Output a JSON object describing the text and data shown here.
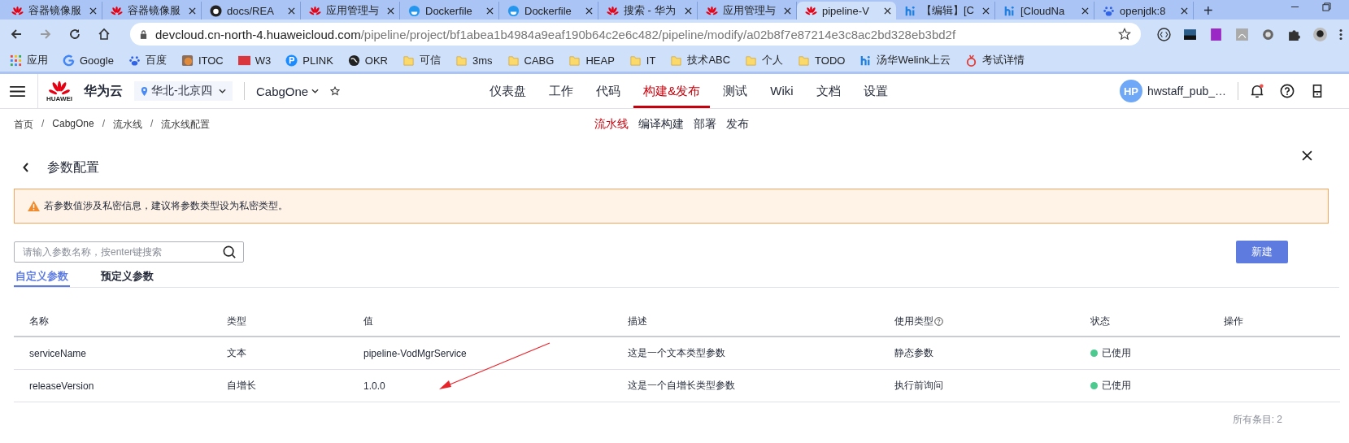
{
  "browser": {
    "tabs": [
      {
        "title": "容器镜像服",
        "kind": "huawei",
        "selected": false
      },
      {
        "title": "容器镜像服",
        "kind": "huawei",
        "selected": false
      },
      {
        "title": "docs/REA",
        "kind": "github",
        "selected": false
      },
      {
        "title": "应用管理与",
        "kind": "huawei",
        "selected": false
      },
      {
        "title": "Dockerfile",
        "kind": "docker",
        "selected": false
      },
      {
        "title": "Dockerfile",
        "kind": "docker",
        "selected": false
      },
      {
        "title": "搜索 - 华为",
        "kind": "huawei",
        "selected": false
      },
      {
        "title": "应用管理与",
        "kind": "huawei",
        "selected": false
      },
      {
        "title": "pipeline-V",
        "kind": "huawei",
        "selected": true
      },
      {
        "title": "【编辑】[C",
        "kind": "welink",
        "selected": false
      },
      {
        "title": "[CloudNa",
        "kind": "welink",
        "selected": false
      },
      {
        "title": "openjdk:8",
        "kind": "baidu",
        "selected": false
      }
    ],
    "new_tab": "+",
    "url_host": "devcloud.cn-north-4.huaweicloud.com",
    "url_path": "/pipeline/project/bf1abea1b4984a9eaf190b64c2e6c482/pipeline/modify/a02b8f7e87214e3c8ac2bd328eb3bd2f",
    "bookmarks": [
      {
        "label": "应用",
        "kind": "apps"
      },
      {
        "label": "Google",
        "kind": "google"
      },
      {
        "label": "百度",
        "kind": "baidu"
      },
      {
        "label": "ITOC",
        "kind": "itoc"
      },
      {
        "label": "W3",
        "kind": "w3"
      },
      {
        "label": "PLINK",
        "kind": "plink"
      },
      {
        "label": "OKR",
        "kind": "okr"
      },
      {
        "label": "可信",
        "kind": "folder"
      },
      {
        "label": "3ms",
        "kind": "folder"
      },
      {
        "label": "CABG",
        "kind": "folder"
      },
      {
        "label": "HEAP",
        "kind": "folder"
      },
      {
        "label": "IT",
        "kind": "folder"
      },
      {
        "label": "技术ABC",
        "kind": "folder"
      },
      {
        "label": "个人",
        "kind": "folder"
      },
      {
        "label": "TODO",
        "kind": "folder"
      },
      {
        "label": "汤华Welink上云",
        "kind": "welink"
      },
      {
        "label": "考试详情",
        "kind": "exam"
      }
    ]
  },
  "header": {
    "logo_text": "HUAWEI",
    "brand": "华为云",
    "region": "华北-北京四",
    "project": "CabgOne",
    "nav": [
      {
        "label": "仪表盘",
        "selected": false
      },
      {
        "label": "工作",
        "selected": false
      },
      {
        "label": "代码",
        "selected": false
      },
      {
        "label": "构建&发布",
        "selected": true
      },
      {
        "label": "测试",
        "selected": false
      },
      {
        "label": "Wiki",
        "selected": false
      },
      {
        "label": "文档",
        "selected": false
      },
      {
        "label": "设置",
        "selected": false
      }
    ],
    "avatar": "HP",
    "username": "hwstaff_pub_…"
  },
  "breadcrumb": {
    "items": [
      "首页",
      "CabgOne",
      "流水线",
      "流水线配置"
    ],
    "separators": [
      "/",
      "/",
      "/"
    ]
  },
  "subnav": [
    {
      "label": "流水线",
      "selected": true
    },
    {
      "label": "编译构建",
      "selected": false
    },
    {
      "label": "部署",
      "selected": false
    },
    {
      "label": "发布",
      "selected": false
    }
  ],
  "page": {
    "title": "参数配置",
    "warning": "若参数值涉及私密信息，建议将参数类型设为私密类型。",
    "search": {
      "placeholder": "请输入参数名称，按enter键搜索"
    },
    "new_button": "新建",
    "tabs": [
      {
        "label": "自定义参数",
        "selected": true
      },
      {
        "label": "预定义参数",
        "selected": false
      }
    ]
  },
  "table": {
    "columns": [
      "名称",
      "类型",
      "值",
      "描述",
      "使用类型",
      "状态",
      "操作"
    ],
    "rows": [
      {
        "name": "serviceName",
        "type": "文本",
        "value": "pipeline-VodMgrService",
        "description": "这是一个文本类型参数",
        "usage": "静态参数",
        "status": "已使用",
        "color": "#4cc98f"
      },
      {
        "name": "releaseVersion",
        "type": "自增长",
        "value": "1.0.0",
        "description": "这是一个自增长类型参数",
        "usage": "执行前询问",
        "status": "已使用",
        "color": "#4cc98f"
      }
    ],
    "total": "所有条目: 2"
  }
}
